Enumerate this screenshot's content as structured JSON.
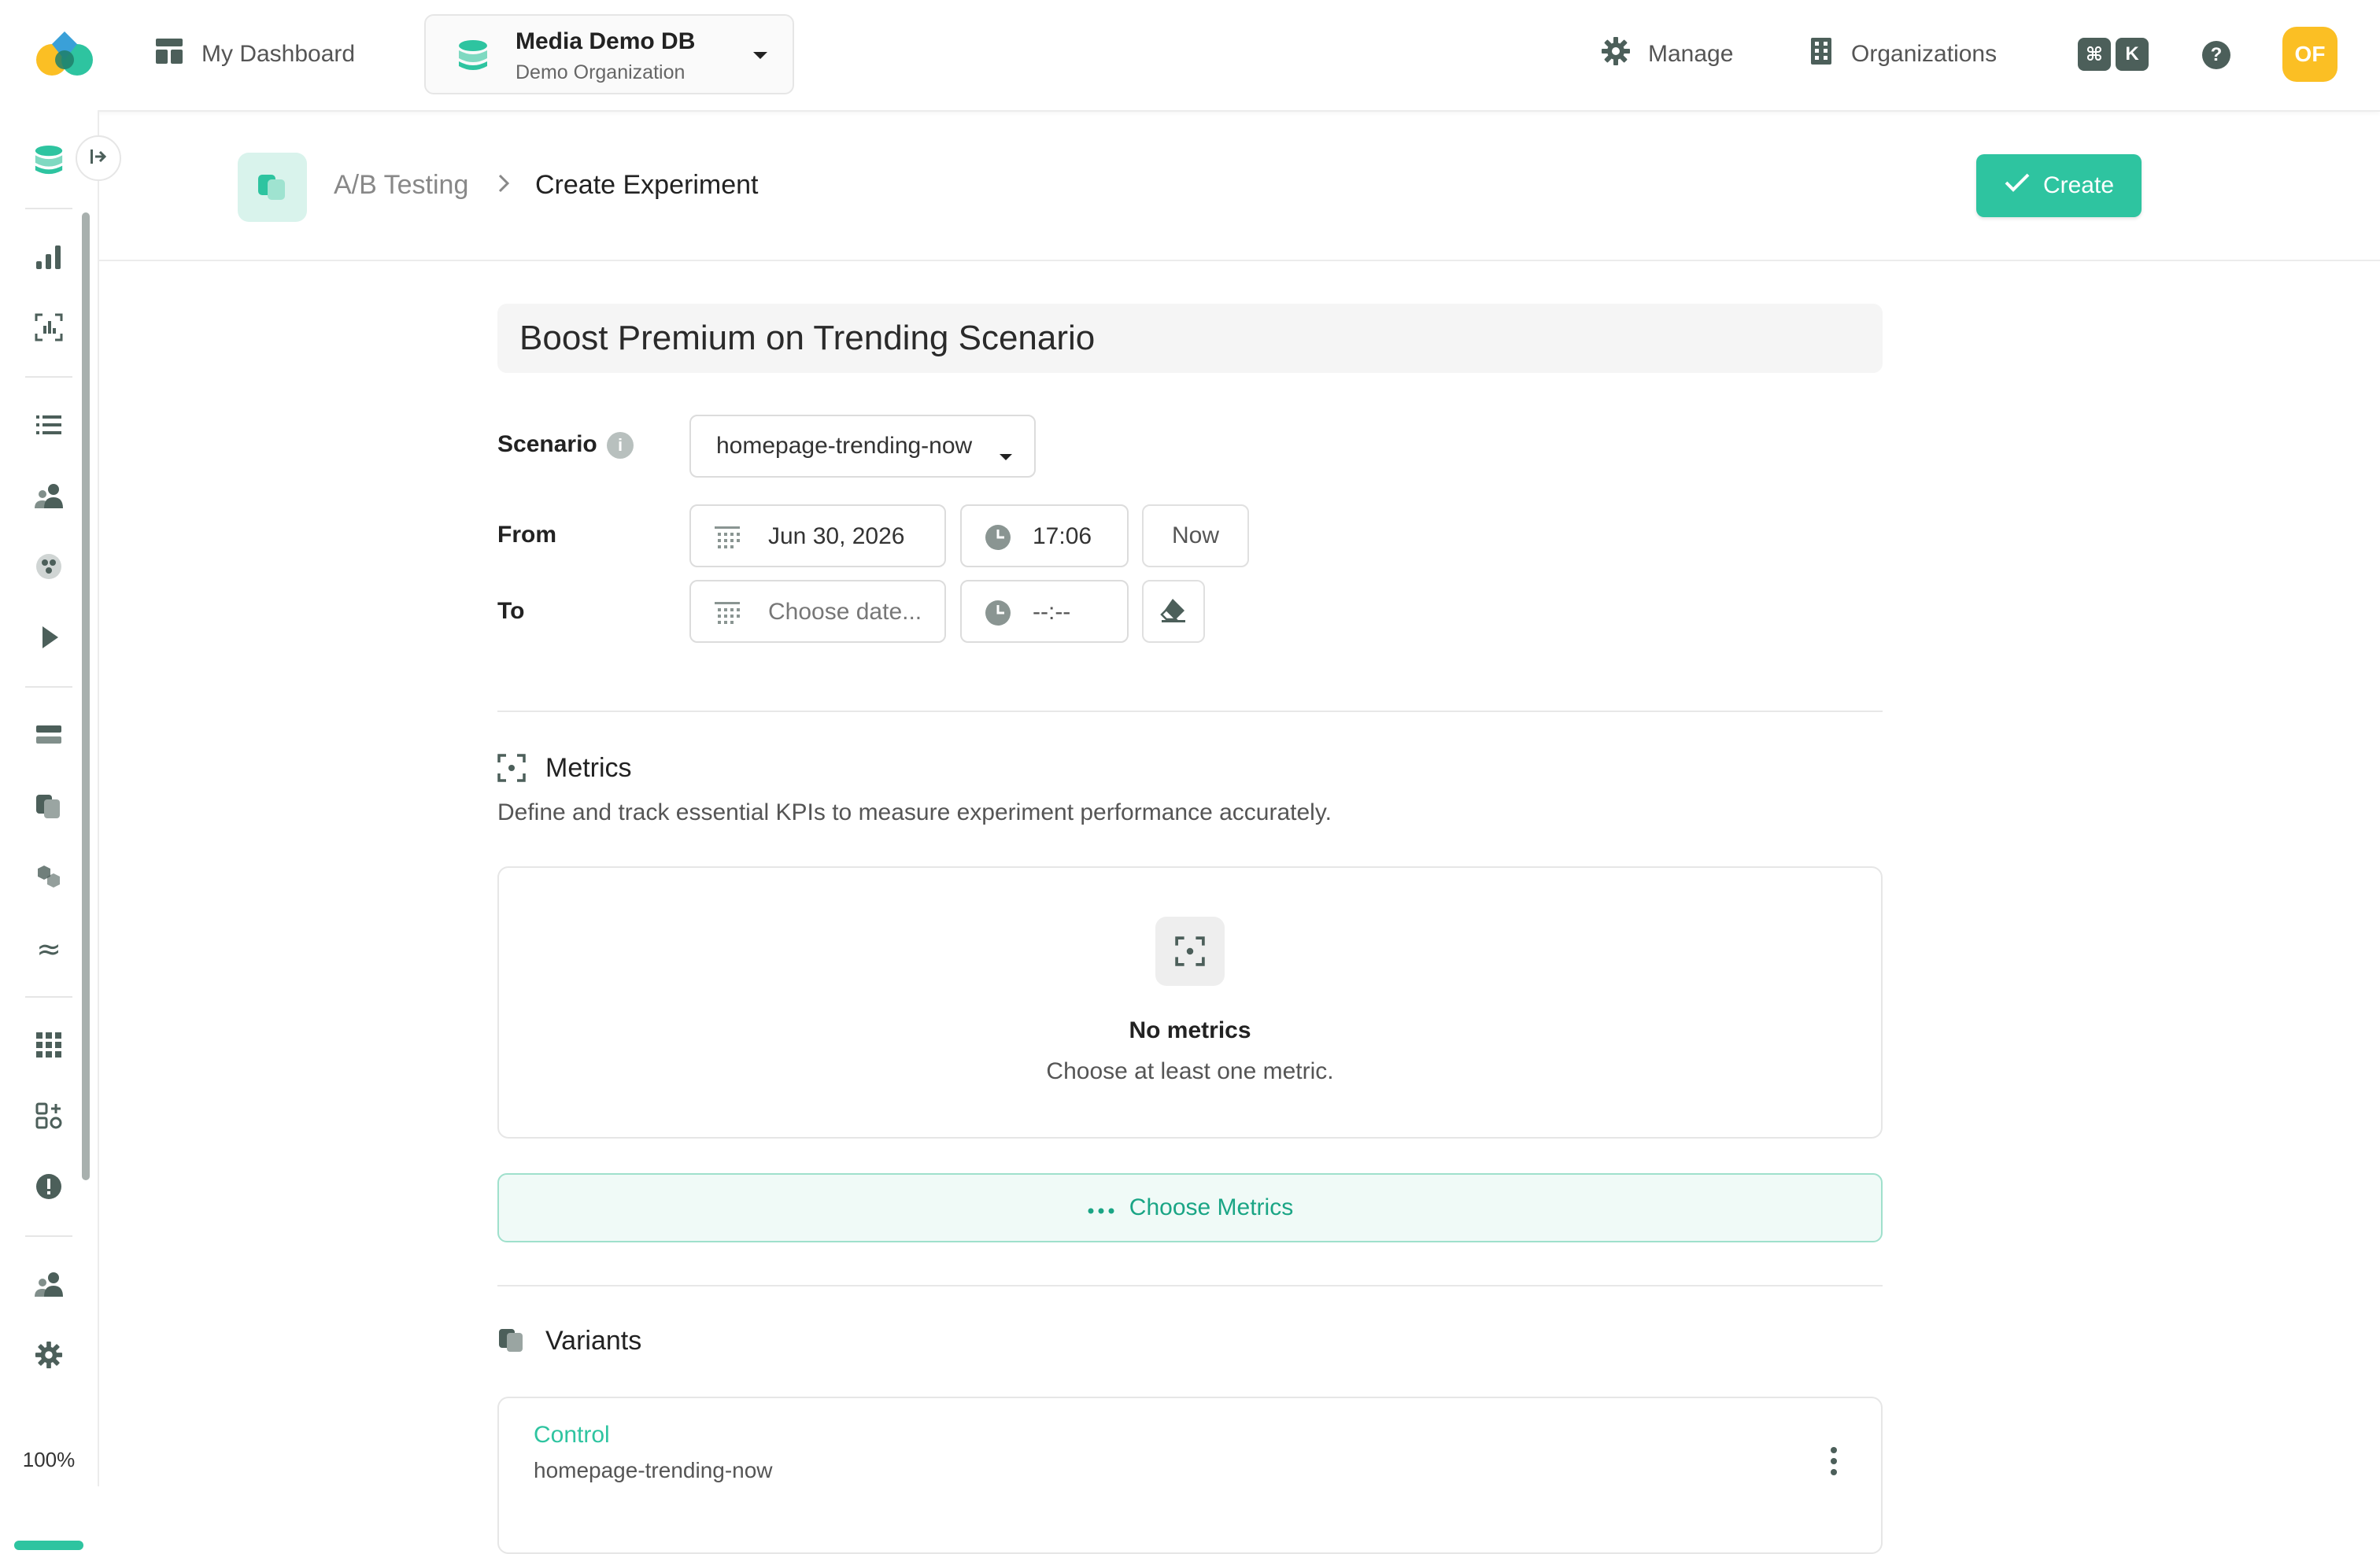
{
  "topbar": {
    "dashboard_label": "My Dashboard",
    "db_name": "Media Demo DB",
    "db_org": "Demo Organization",
    "manage_label": "Manage",
    "organizations_label": "Organizations",
    "shortcut_key_1": "⌘",
    "shortcut_key_2": "K",
    "help_label": "?",
    "avatar_initials": "OF"
  },
  "sidebar": {
    "usage_percent": 100,
    "usage_label": "100%"
  },
  "header": {
    "breadcrumb_parent": "A/B Testing",
    "breadcrumb_current": "Create Experiment",
    "create_label": "Create"
  },
  "form": {
    "experiment_name": "Boost Premium on Trending Scenario",
    "scenario_label": "Scenario",
    "scenario_value": "homepage-trending-now",
    "from_label": "From",
    "from_date": "Jun 30, 2026",
    "from_time": "17:06",
    "now_label": "Now",
    "to_label": "To",
    "to_date_placeholder": "Choose date...",
    "to_time_placeholder": "--:--"
  },
  "metrics": {
    "title": "Metrics",
    "description": "Define and track essential KPIs to measure experiment performance accurately.",
    "empty_title": "No metrics",
    "empty_subtitle": "Choose at least one metric.",
    "choose_label": "Choose Metrics"
  },
  "variants": {
    "title": "Variants",
    "items": [
      {
        "name": "Control",
        "scenario": "homepage-trending-now"
      }
    ]
  },
  "colors": {
    "accent": "#2ec4a0",
    "avatar": "#fbbf24"
  }
}
